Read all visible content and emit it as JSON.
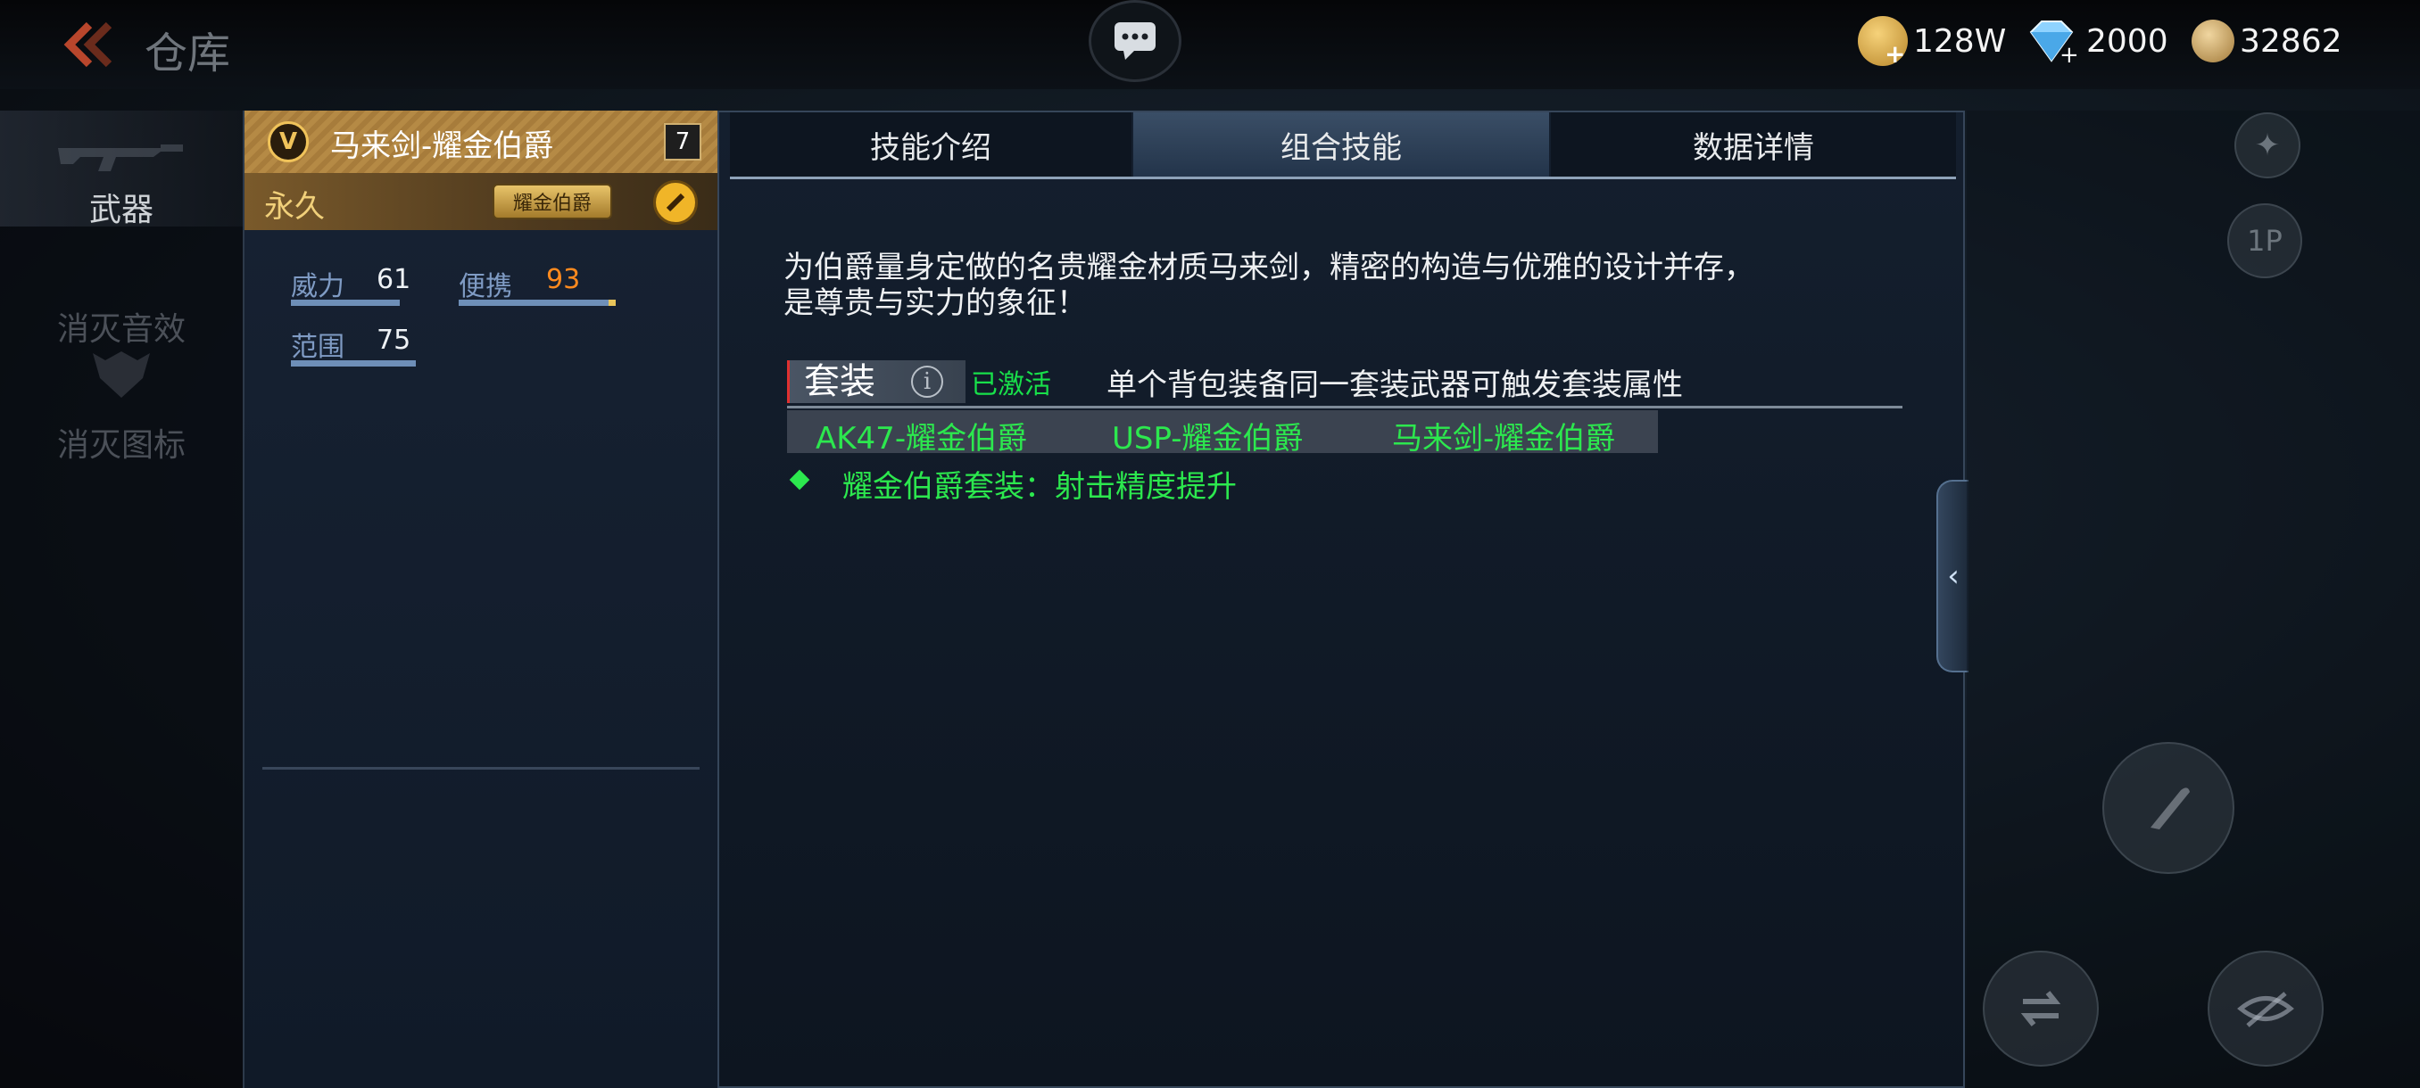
{
  "header": {
    "title": "仓库",
    "currencies": [
      {
        "icon": "gold-coin-icon",
        "value": "128W"
      },
      {
        "icon": "diamond-icon",
        "value": "2000"
      },
      {
        "icon": "honor-coin-icon",
        "value": "32862"
      }
    ]
  },
  "sidebar": {
    "items": [
      {
        "label": "武器",
        "active": true
      },
      {
        "label": "消灭音效",
        "active": false
      },
      {
        "label": "消灭图标",
        "active": false
      }
    ]
  },
  "card": {
    "name": "马来剑-耀金伯爵",
    "level": "7",
    "duration": "永久",
    "tag": "耀金伯爵",
    "stats": [
      {
        "label": "威力",
        "value": "61"
      },
      {
        "label": "便携",
        "value": "93"
      },
      {
        "label": "范围",
        "value": "75"
      }
    ]
  },
  "tabs": [
    "技能介绍",
    "组合技能",
    "数据详情"
  ],
  "active_tab": "组合技能",
  "detail": {
    "description": "为伯爵量身定做的名贵耀金材质马来剑，精密的构造与优雅的设计并存，\n是尊贵与实力的象征！",
    "set_label": "套装",
    "set_status": "已激活",
    "set_hint": "单个背包装备同一套装武器可触发套装属性",
    "set_items": [
      "AK47-耀金伯爵",
      "USP-耀金伯爵",
      "马来剑-耀金伯爵"
    ],
    "set_effect": "耀金伯爵套装：射击精度提升"
  },
  "colors": {
    "accent_gold": "#b58a45",
    "active_green": "#2ce84e",
    "portable_orange": "#ff8a1e"
  }
}
